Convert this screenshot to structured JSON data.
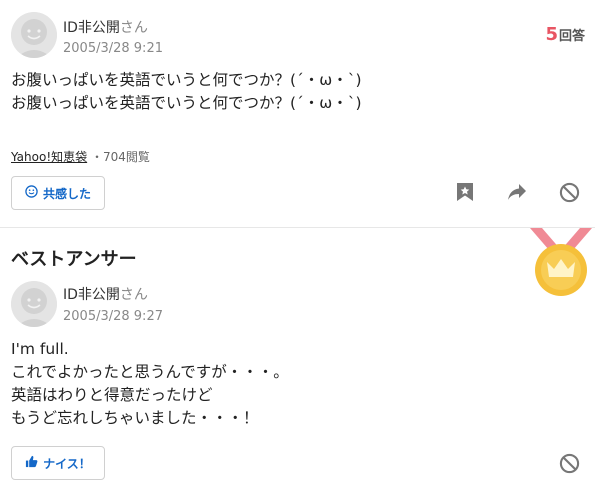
{
  "question": {
    "user_name": "ID非公開",
    "user_suffix": "さん",
    "date": "2005/3/28 9:21",
    "answer_count": "5",
    "answer_count_label": "回答",
    "lines": [
      "お腹いっぱいを英語でいうと何でつか？(´・ω・`)",
      "お腹いっぱいを英語でいうと何でつか？(´・ω・`)"
    ],
    "source": "Yahoo!知恵袋",
    "views": "・704閲覧",
    "empathy_label": "共感した"
  },
  "best_answer": {
    "section_title": "ベストアンサー",
    "user_name": "ID非公開",
    "user_suffix": "さん",
    "date": "2005/3/28 9:27",
    "lines": [
      "I'm full.",
      "これでよかったと思うんですが・・・。",
      "英語はわりと得意だったけど",
      "もうど忘れしちゃいました・・・！"
    ],
    "nice_label": "ナイス！"
  },
  "colors": {
    "accent_blue": "#1468c8",
    "count_red": "#e85563",
    "medal_gold": "#f5c03a",
    "ribbon_pink": "#f08a95"
  },
  "icons": [
    "avatar-placeholder",
    "smile-icon",
    "bookmark-icon",
    "share-icon",
    "block-icon",
    "thumbs-up-icon",
    "gold-medal-crown"
  ]
}
